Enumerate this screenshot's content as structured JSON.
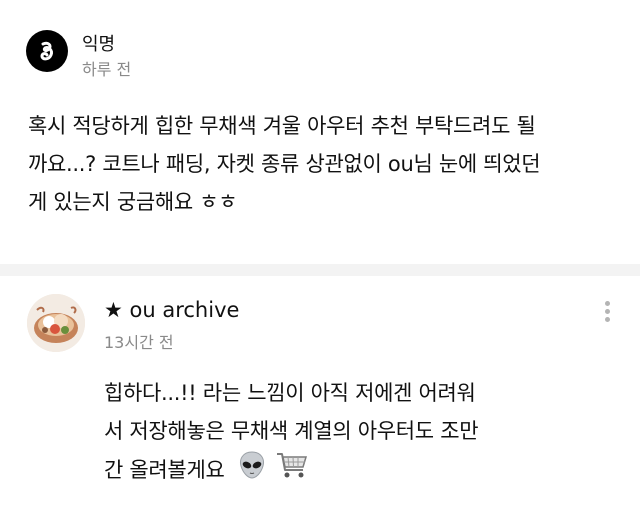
{
  "post": {
    "author": "익명",
    "time": "하루 전",
    "body_lines": [
      "혹시 적당하게 힙한 무채색 겨울 아우터 추천 부탁드려도 될",
      "까요...? 코트나 패딩, 자켓 종류 상관없이 ou님 눈에 띄었던",
      "게 있는지 궁금해요 ㅎㅎ"
    ]
  },
  "comment": {
    "author": "★ ou archive",
    "time": "13시간 전",
    "body_lines": [
      "힙하다...!! 라는 느낌이 아직 저에겐 어려워",
      "서 저장해놓은 무채색 계열의 아우터도 조만",
      "간 올려볼게요"
    ],
    "emojis": [
      "alien-icon",
      "shopping-cart-icon"
    ]
  }
}
